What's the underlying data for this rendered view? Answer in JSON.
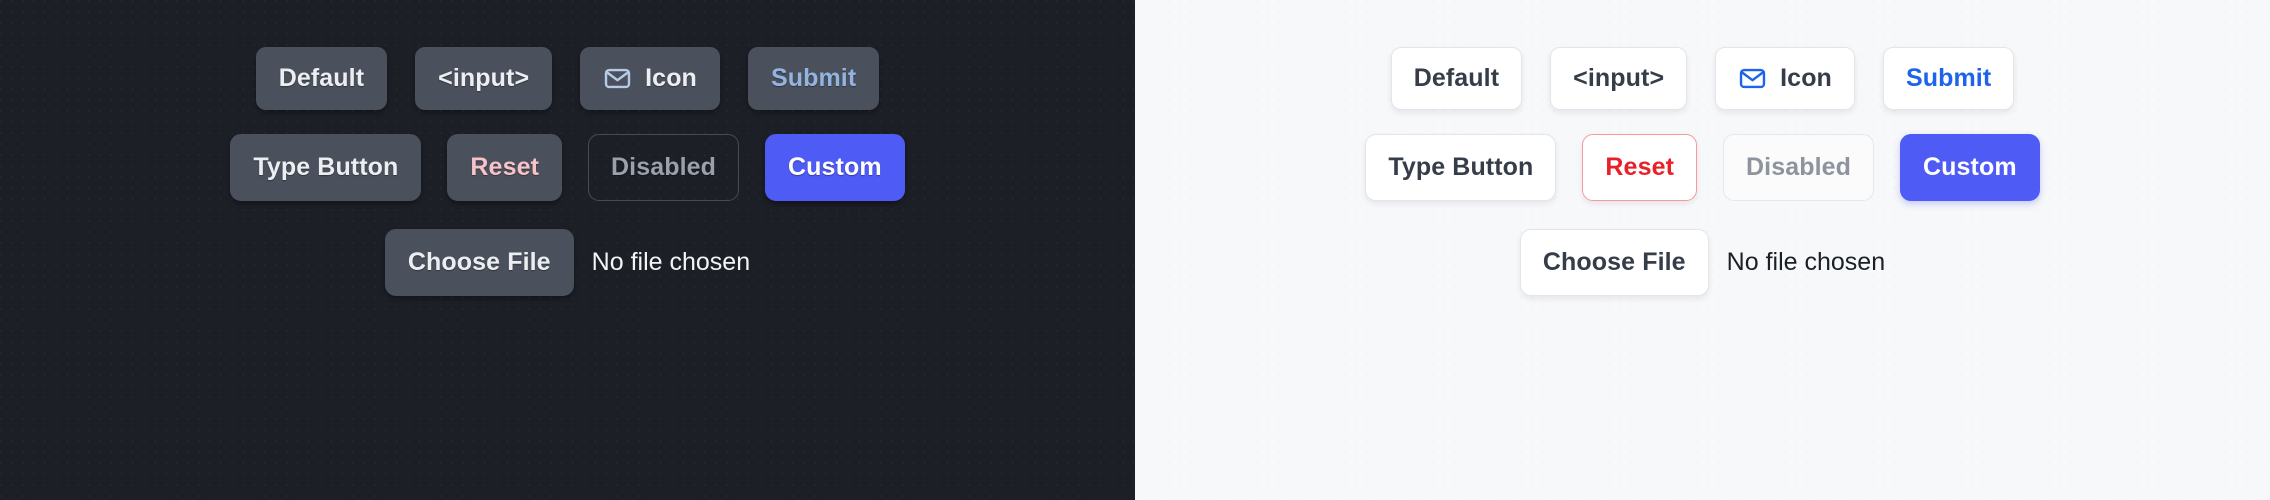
{
  "panels": [
    {
      "theme": "dark",
      "background_color": "#1c1f26",
      "rows": {
        "row_one": [
          {
            "label": "Default",
            "name": "default-button"
          },
          {
            "label": "<input>",
            "name": "input-element-button"
          },
          {
            "label": "Icon",
            "name": "icon-button",
            "icon": "mail-icon"
          },
          {
            "label": "Submit",
            "name": "submit-button"
          }
        ],
        "row_two": [
          {
            "label": "Type Button",
            "name": "type-button"
          },
          {
            "label": "Reset",
            "name": "reset-button"
          },
          {
            "label": "Disabled",
            "name": "disabled-button"
          },
          {
            "label": "Custom",
            "name": "custom-button"
          }
        ],
        "file_row": {
          "button_label": "Choose File",
          "status_text": "No file chosen"
        }
      },
      "colors": {
        "button_fill": "#4a515c",
        "button_text": "#eceef1",
        "submit_text": "#93b3e0",
        "reset_text": "#f7c2c8",
        "disabled_border": "#454b55",
        "disabled_text": "#9aa1ab",
        "custom_fill": "#4f5bf5",
        "custom_text": "#ffffff",
        "icon_stroke": "#b7cbe6"
      }
    },
    {
      "theme": "light",
      "background_color": "#f7f8fa",
      "rows": {
        "row_one": [
          {
            "label": "Default",
            "name": "default-button"
          },
          {
            "label": "<input>",
            "name": "input-element-button"
          },
          {
            "label": "Icon",
            "name": "icon-button",
            "icon": "mail-icon"
          },
          {
            "label": "Submit",
            "name": "submit-button"
          }
        ],
        "row_two": [
          {
            "label": "Type Button",
            "name": "type-button"
          },
          {
            "label": "Reset",
            "name": "reset-button"
          },
          {
            "label": "Disabled",
            "name": "disabled-button"
          },
          {
            "label": "Custom",
            "name": "custom-button"
          }
        ],
        "file_row": {
          "button_label": "Choose File",
          "status_text": "No file chosen"
        }
      },
      "colors": {
        "button_fill": "#ffffff",
        "button_text": "#353d48",
        "button_border": "#e2e5ea",
        "submit_text": "#1d64e8",
        "reset_text": "#e8202a",
        "reset_border": "#f89a9a",
        "disabled_fill": "#fbfbfc",
        "disabled_text": "#8d949e",
        "custom_fill": "#4f5bf5",
        "custom_text": "#ffffff",
        "icon_stroke": "#1d64e8"
      }
    }
  ]
}
